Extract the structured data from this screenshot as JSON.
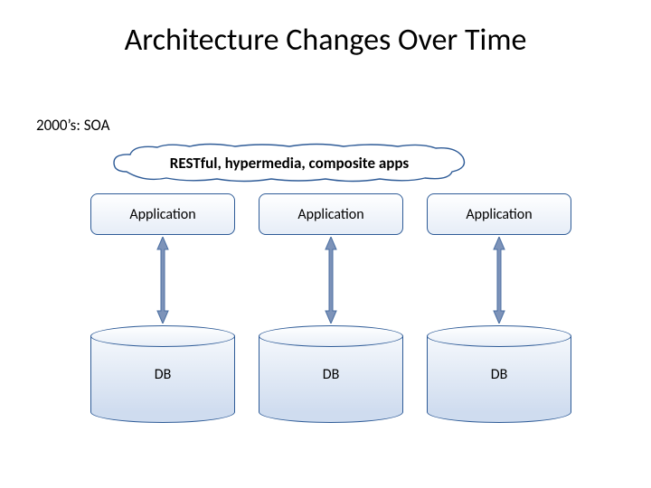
{
  "title": "Architecture Changes Over Time",
  "subtitle": "2000’s: SOA",
  "cloud_label": "RESTful, hypermedia, composite apps",
  "columns": [
    {
      "app_label": "Application",
      "db_label": "DB"
    },
    {
      "app_label": "Application",
      "db_label": "DB"
    },
    {
      "app_label": "Application",
      "db_label": "DB"
    }
  ],
  "colors": {
    "stroke": "#2e5b97",
    "arrow_fill": "#7d93b9",
    "arrow_stroke": "#4a6ea1"
  }
}
